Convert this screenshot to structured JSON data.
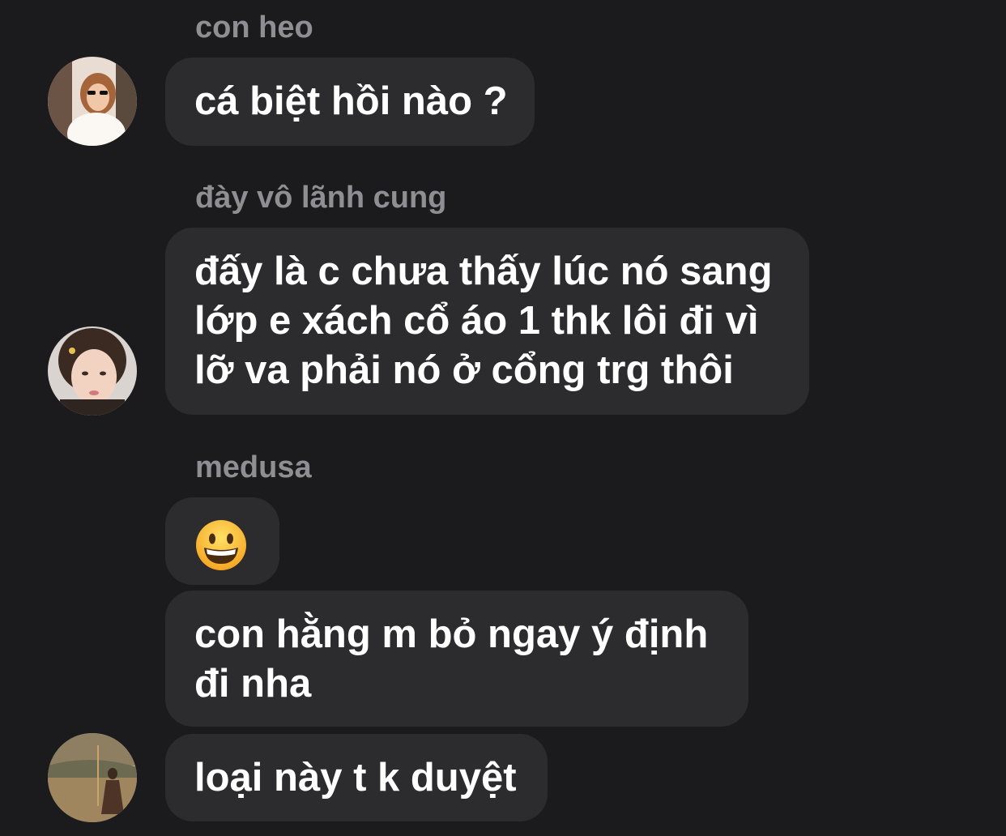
{
  "messages": [
    {
      "sender": "con heo",
      "lines": [
        "cá biệt hồi nào ?"
      ],
      "avatar": "avatar-woman-sunglasses"
    },
    {
      "sender": "đày vô lãnh cung",
      "lines": [
        "đấy là c chưa thấy lúc nó sang",
        "lớp e xách cổ áo 1 thk lôi đi vì",
        "lỡ va phải nó ở cổng trg thôi"
      ],
      "avatar": "avatar-girl-portrait"
    },
    {
      "sender": "medusa",
      "emoji": "grinning-face-emoji",
      "lines2": [
        "con hằng m bỏ ngay ý định",
        "đi nha"
      ],
      "lines3": [
        "loại này t k duyệt"
      ],
      "avatar": "avatar-person-landscape"
    }
  ],
  "colors": {
    "background": "#1b1b1d",
    "bubble": "#2c2c2e",
    "sender_text": "#8e8e93",
    "message_text": "#ffffff"
  }
}
